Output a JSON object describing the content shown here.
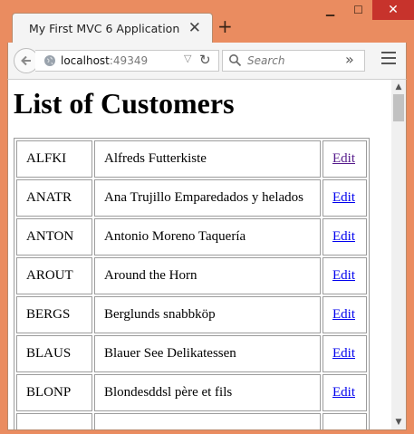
{
  "window": {
    "minimize_label": "▁",
    "maximize_label": "☐",
    "close_label": "✕"
  },
  "tab": {
    "title": "My First MVC 6 Application",
    "close_label": "✕",
    "new_tab_label": "+"
  },
  "navbar": {
    "url_host": "localhost",
    "url_port": ":49349",
    "search_placeholder": "Search",
    "overflow_label": "»",
    "reload_label": "↻",
    "dropdown_label": "▽"
  },
  "page": {
    "heading": "List of Customers",
    "customers": [
      {
        "id": "ALFKI",
        "name": "Alfreds Futterkiste",
        "action": "Edit",
        "visited": true
      },
      {
        "id": "ANATR",
        "name": "Ana Trujillo Emparedados y helados",
        "action": "Edit",
        "visited": false
      },
      {
        "id": "ANTON",
        "name": "Antonio Moreno Taquería",
        "action": "Edit",
        "visited": false
      },
      {
        "id": "AROUT",
        "name": "Around the Horn",
        "action": "Edit",
        "visited": false
      },
      {
        "id": "BERGS",
        "name": "Berglunds snabbköp",
        "action": "Edit",
        "visited": false
      },
      {
        "id": "BLAUS",
        "name": "Blauer See Delikatessen",
        "action": "Edit",
        "visited": false
      },
      {
        "id": "BLONP",
        "name": "Blondesddsl père et fils",
        "action": "Edit",
        "visited": false
      },
      {
        "id": "",
        "name": "",
        "action": "",
        "visited": false
      }
    ]
  },
  "icons": {
    "back": "back-arrow-icon",
    "globe": "globe-icon",
    "search": "search-icon",
    "menu": "hamburger-menu-icon"
  },
  "colors": {
    "frame": "#ea8c60",
    "close_button": "#c7332c",
    "link": "#0000ee",
    "visited_link": "#551a8b"
  }
}
